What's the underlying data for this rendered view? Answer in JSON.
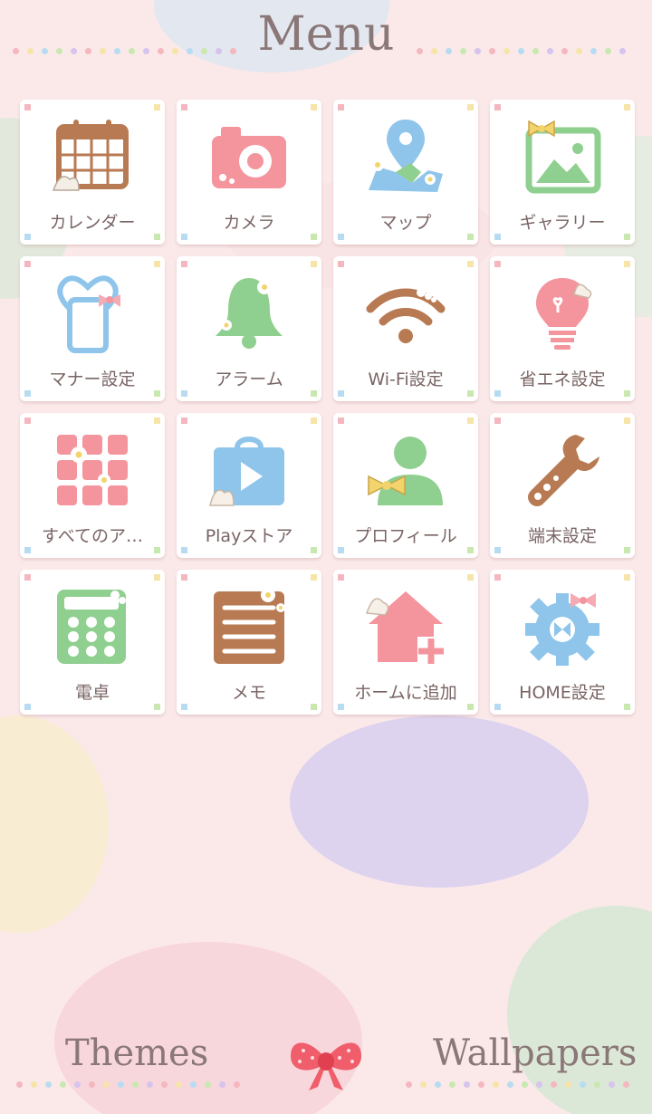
{
  "header": {
    "title": "Menu"
  },
  "apps": [
    {
      "label": "カレンダー",
      "icon": "calendar-icon"
    },
    {
      "label": "カメラ",
      "icon": "camera-icon"
    },
    {
      "label": "マップ",
      "icon": "map-icon"
    },
    {
      "label": "ギャラリー",
      "icon": "gallery-icon"
    },
    {
      "label": "マナー設定",
      "icon": "manner-mode-icon"
    },
    {
      "label": "アラーム",
      "icon": "alarm-bell-icon"
    },
    {
      "label": "Wi-Fi設定",
      "icon": "wifi-icon"
    },
    {
      "label": "省エネ設定",
      "icon": "energy-saving-bulb-icon"
    },
    {
      "label": "すべてのア…",
      "icon": "all-apps-icon"
    },
    {
      "label": "Playストア",
      "icon": "play-store-icon"
    },
    {
      "label": "プロフィール",
      "icon": "profile-icon"
    },
    {
      "label": "端末設定",
      "icon": "device-settings-wrench-icon"
    },
    {
      "label": "電卓",
      "icon": "calculator-icon"
    },
    {
      "label": "メモ",
      "icon": "memo-icon"
    },
    {
      "label": "ホームに追加",
      "icon": "add-to-home-icon"
    },
    {
      "label": "HOME設定",
      "icon": "home-settings-gear-icon"
    }
  ],
  "footer": {
    "themes_label": "Themes",
    "wallpapers_label": "Wallpapers"
  },
  "colors": {
    "pink": "#f4959e",
    "blue": "#8fc5ea",
    "green": "#8fcf8f",
    "brown": "#b87a52",
    "text": "#7a6464"
  }
}
